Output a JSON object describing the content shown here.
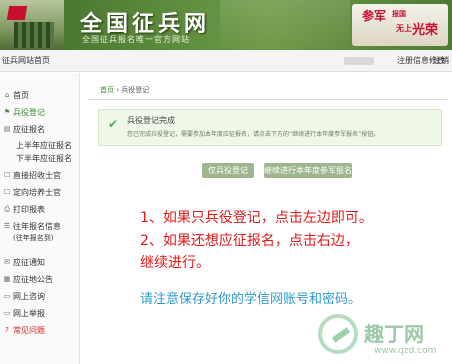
{
  "header": {
    "title": "全国征兵网",
    "subtitle": "全国征兵报名唯一官方网站",
    "slogan": {
      "part1": "参军",
      "part2": "报国",
      "part3": "无上",
      "part4": "光荣"
    }
  },
  "topbar": {
    "home_label": "征兵网站首页",
    "account_label": "注册信息修改",
    "logout_label": "注销"
  },
  "sidebar": {
    "home": {
      "icon": "home-icon",
      "label": "首页"
    },
    "military_registration": {
      "icon": "flag-icon",
      "label": "兵役登记"
    },
    "enlist_application": {
      "icon": "doc-icon",
      "label": "应征报名"
    },
    "first_half": "上半年应征报名",
    "second_half": "下半年应征报名",
    "direct_recruit": {
      "icon": "person-icon",
      "label": "直接招收士官"
    },
    "orientation_recruit": {
      "icon": "person-icon",
      "label": "定向培养士官"
    },
    "print_form": {
      "icon": "printer-icon",
      "label": "打印报表"
    },
    "past_info": {
      "icon": "list-icon",
      "label": "往年报名信息"
    },
    "past_info_note": "(往年报名到)",
    "notice": {
      "icon": "mail-icon",
      "label": "应征通知"
    },
    "announcement": {
      "icon": "bulletin-icon",
      "label": "应征地公告"
    },
    "online_consult": {
      "icon": "chat-icon",
      "label": "网上咨询"
    },
    "online_report": {
      "icon": "report-icon",
      "label": "网上举报"
    },
    "faq": {
      "icon": "question-icon",
      "label": "常见问题"
    }
  },
  "main": {
    "breadcrumb": {
      "home": "首页",
      "separator": "›",
      "current": "兵役登记"
    },
    "alert": {
      "title": "兵役登记完成",
      "text": "您已完成兵役登记，需要参加本年度应征报名，请点击下方的“继续进行本年度参军报名”按钮。"
    },
    "buttons": {
      "print": "仅兵役登记",
      "continue": "继续进行本年度参军报名"
    },
    "notes": {
      "line1": "1、如果只兵役登记，点击左边即可。",
      "line2": "2、如果还想应征报名，点击右边，",
      "line3": "继续进行。",
      "line4": "请注意保存好你的学信网账号和密码。"
    }
  },
  "watermark": {
    "text": "趣丁网",
    "url": "www.qzd.com"
  },
  "colors": {
    "header_green": "#5b8a3c",
    "active_green": "#3d8b2d",
    "button_green": "#9eb690",
    "alert_bg": "#eef7e8",
    "note_red": "#e01a1a",
    "note_blue": "#2e9ac9",
    "faq_red": "#d62020"
  }
}
